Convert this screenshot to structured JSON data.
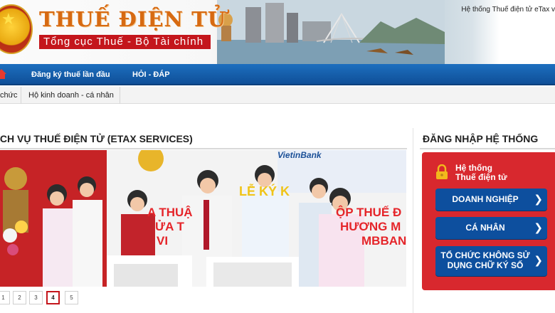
{
  "header": {
    "title": "THUẾ ĐIỆN TỬ",
    "subtitle": "Tổng cục Thuế - Bộ Tài chính",
    "right_text": "Hệ thống Thuế điện tử eTax v"
  },
  "nav": {
    "items": [
      {
        "label": "Đăng ký thuế lần đầu"
      },
      {
        "label": "HỎI - ĐÁP"
      }
    ]
  },
  "subtabs": [
    {
      "label": "chức"
    },
    {
      "label": "Hộ kinh doanh - cá nhân"
    }
  ],
  "main": {
    "title": "ỊCH VỤ THUẾ ĐIỆN TỬ (ETAX SERVICES)",
    "slide": {
      "bank_logo": "VietinBank",
      "banner_lines": [
        "A THUẬ",
        "ỬA T",
        "VI",
        "ỘP THUẾ Đ",
        "HƯƠNG M",
        "MBBANK",
        "LỄ KÝ K"
      ]
    },
    "pagination": {
      "pages": [
        "1",
        "2",
        "3",
        "4",
        "5"
      ],
      "current": "4"
    }
  },
  "login": {
    "title": "ĐĂNG NHẬP HỆ THỐNG",
    "caption_line1": "Hệ thống",
    "caption_line2": "Thuế điện tử",
    "buttons": {
      "enterprise": "DOANH NGHIỆP",
      "individual": "CÁ NHÂN",
      "org_line1": "TỔ CHỨC KHÔNG SỬ",
      "org_line2": "DỤNG CHỮ KÝ SỐ"
    },
    "chevron": "❯"
  },
  "colors": {
    "brand_red": "#c4161c",
    "nav_blue": "#1d6fbf",
    "button_blue": "#0d4f9e",
    "title_orange": "#d76a12"
  }
}
